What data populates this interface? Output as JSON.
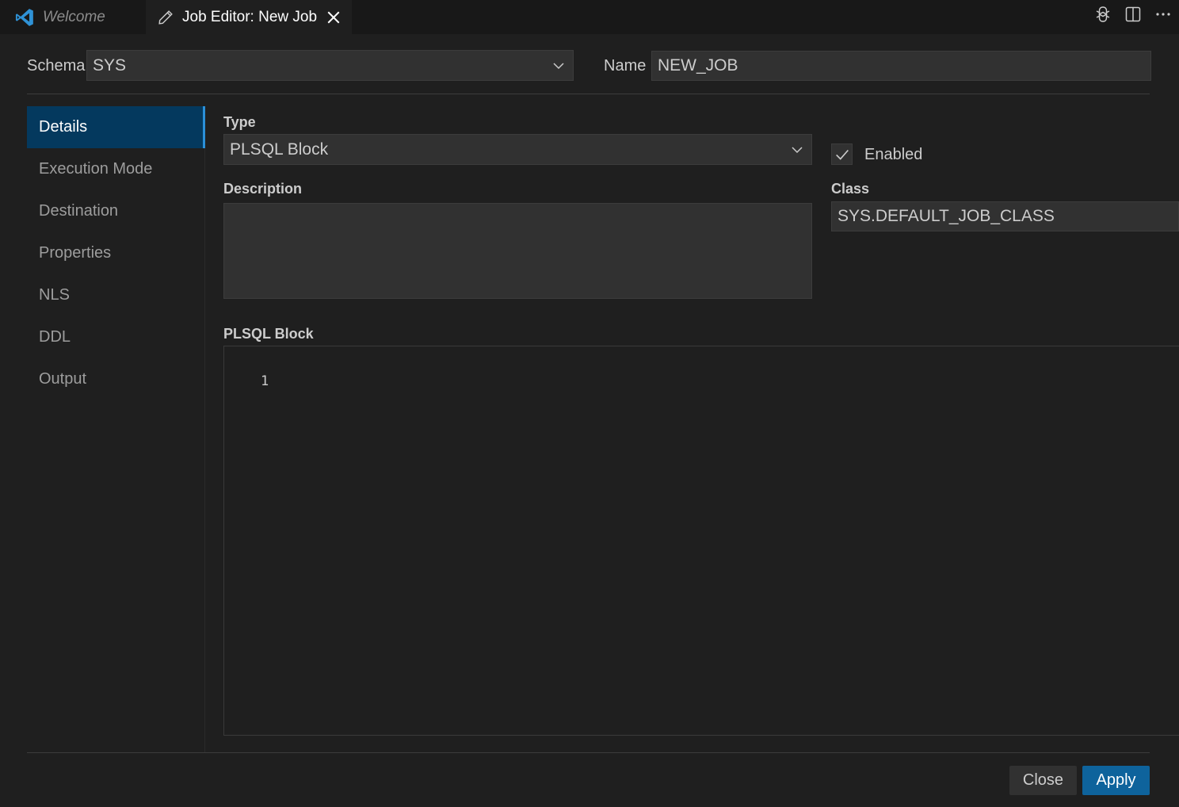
{
  "tabs": [
    {
      "label": "Welcome",
      "icon": "vscode-logo-icon"
    },
    {
      "label": "Job Editor: New Job",
      "icon": "pencil-icon",
      "close_icon": "close-icon"
    }
  ],
  "top_actions": [
    "chatgpt-icon",
    "split-editor-icon",
    "more-actions-icon"
  ],
  "header": {
    "schema_label": "Schema",
    "schema_value": "SYS",
    "name_label": "Name",
    "name_value": "NEW_JOB"
  },
  "nav": {
    "items": [
      "Details",
      "Execution Mode",
      "Destination",
      "Properties",
      "NLS",
      "DDL",
      "Output"
    ],
    "active": "Details"
  },
  "details": {
    "type_label": "Type",
    "type_value": "PLSQL Block",
    "enabled_label": "Enabled",
    "enabled_checked": true,
    "description_label": "Description",
    "description_value": "",
    "class_label": "Class",
    "class_value": "SYS.DEFAULT_JOB_CLASS",
    "plsql_label": "PLSQL Block",
    "line_number": "1"
  },
  "buttons": {
    "close_label": "Close",
    "apply_label": "Apply"
  },
  "colors": {
    "accent": "#0e639c",
    "active_nav": "#04395e",
    "background": "#1f1f1f",
    "input": "#313131"
  }
}
